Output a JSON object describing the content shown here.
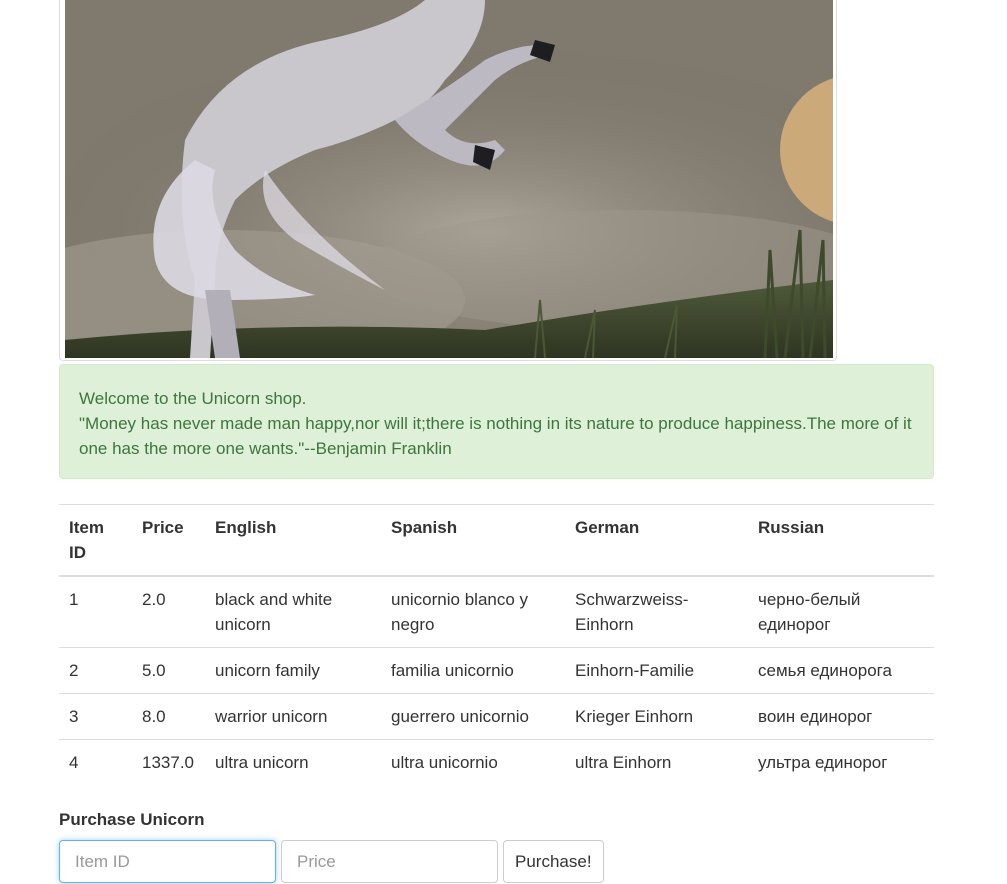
{
  "alert": {
    "welcome": "Welcome to the Unicorn shop.",
    "quote": "\"Money has never made man happy,nor will it;there is nothing in its nature to produce happiness.The more of it one has the more one wants.\"--Benjamin Franklin"
  },
  "table": {
    "headers": {
      "item_id": "Item ID",
      "price": "Price",
      "english": "English",
      "spanish": "Spanish",
      "german": "German",
      "russian": "Russian"
    },
    "rows": [
      {
        "id": "1",
        "price": "2.0",
        "english": "black and white unicorn",
        "spanish": "unicornio blanco y negro",
        "german": "Schwarzweiss-Einhorn",
        "russian": "черно-белый единорог"
      },
      {
        "id": "2",
        "price": "5.0",
        "english": "unicorn family",
        "spanish": "familia unicornio",
        "german": "Einhorn-Familie",
        "russian": "семья единорога"
      },
      {
        "id": "3",
        "price": "8.0",
        "english": "warrior unicorn",
        "spanish": "guerrero unicornio",
        "german": "Krieger Einhorn",
        "russian": "воин единорог"
      },
      {
        "id": "4",
        "price": "1337.0",
        "english": "ultra unicorn",
        "spanish": "ultra unicornio",
        "german": "ultra Einhorn",
        "russian": "ультра единорог"
      }
    ]
  },
  "purchase": {
    "label": "Purchase Unicorn",
    "item_id_placeholder": "Item ID",
    "item_id_value": "",
    "price_placeholder": "Price",
    "price_value": "",
    "button_label": "Purchase!"
  },
  "colors": {
    "alert_bg": "#dff0d8",
    "alert_text": "#3c763d",
    "focus_border": "#66afe9"
  }
}
